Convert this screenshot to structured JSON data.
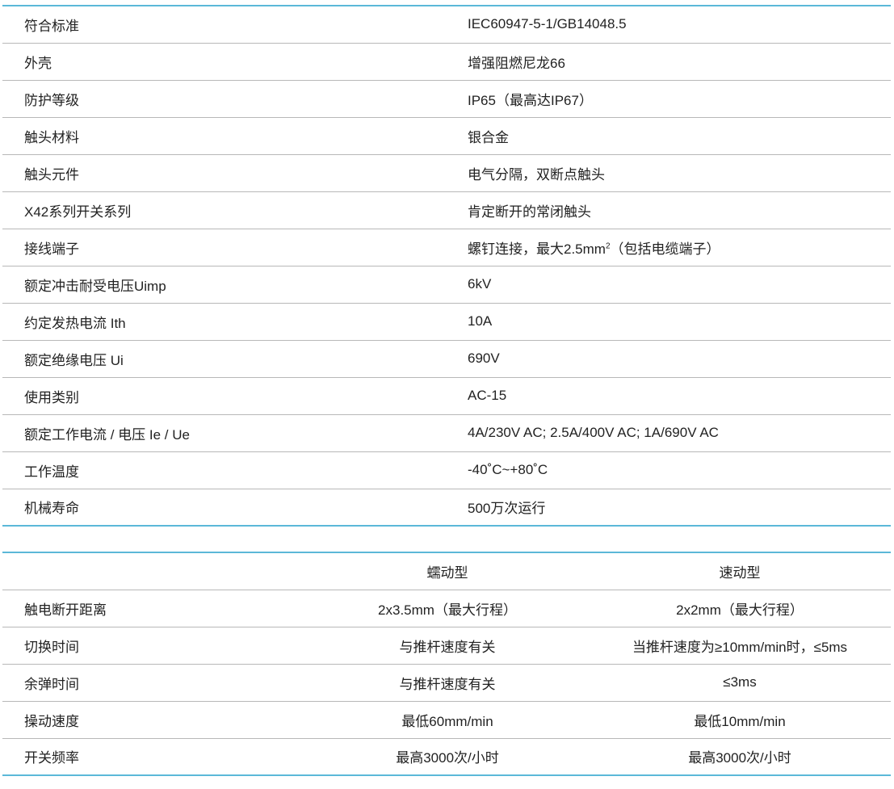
{
  "spec_rows": [
    {
      "label": "符合标准",
      "value": "IEC60947-5-1/GB14048.5"
    },
    {
      "label": "外壳",
      "value": "增强阻燃尼龙66"
    },
    {
      "label": "防护等级",
      "value": "IP65（最高达IP67）"
    },
    {
      "label": "触头材料",
      "value": "银合金"
    },
    {
      "label": "触头元件",
      "value": "电气分隔，双断点触头"
    },
    {
      "label": "X42系列开关系列",
      "value": "肯定断开的常闭触头"
    },
    {
      "label": "接线端子",
      "value_before": "螺钉连接，最大2.5mm",
      "value_sup": "2",
      "value_after": "（包括电缆端子）"
    },
    {
      "label": "额定冲击耐受电压Uimp",
      "value": "6kV"
    },
    {
      "label": "约定发热电流 Ith",
      "value": "10A"
    },
    {
      "label": "额定绝缘电压 Ui",
      "value": "690V"
    },
    {
      "label": "使用类别",
      "value": "AC-15"
    },
    {
      "label": "额定工作电流 / 电压 Ie / Ue",
      "value": "4A/230V AC; 2.5A/400V AC; 1A/690V AC"
    },
    {
      "label": "工作温度",
      "value": "-40˚C~+80˚C"
    },
    {
      "label": "机械寿命",
      "value": "500万次运行"
    }
  ],
  "compare": {
    "header": {
      "col1": "蠕动型",
      "col2": "速动型"
    },
    "rows": [
      {
        "label": "触电断开距离",
        "col1": "2x3.5mm（最大行程）",
        "col2": "2x2mm（最大行程）"
      },
      {
        "label": "切换时间",
        "col1": "与推杆速度有关",
        "col2": "当推杆速度为≥10mm/min时，≤5ms"
      },
      {
        "label": "余弹时间",
        "col1": "与推杆速度有关",
        "col2": "≤3ms"
      },
      {
        "label": "操动速度",
        "col1": "最低60mm/min",
        "col2": "最低10mm/min"
      },
      {
        "label": "开关频率",
        "col1": "最高3000次/小时",
        "col2": "最高3000次/小时"
      }
    ]
  }
}
